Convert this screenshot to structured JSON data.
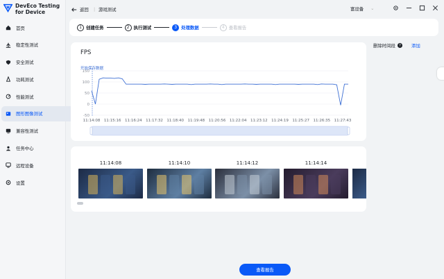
{
  "app": {
    "name_line1": "DevEco Testing",
    "name_line2": "for Device",
    "brand_color": "#0a59f7"
  },
  "sidebar": {
    "items": [
      {
        "label": "首页",
        "icon": "home-icon",
        "active": false
      },
      {
        "label": "稳定性测试",
        "icon": "stability-icon",
        "active": false
      },
      {
        "label": "安全测试",
        "icon": "shield-icon",
        "active": false
      },
      {
        "label": "功耗测试",
        "icon": "power-icon",
        "active": false
      },
      {
        "label": "性能测试",
        "icon": "performance-icon",
        "active": false
      },
      {
        "label": "图形图像测试",
        "icon": "image-icon",
        "active": true
      },
      {
        "label": "兼容性测试",
        "icon": "compatibility-icon",
        "active": false
      },
      {
        "label": "任务中心",
        "icon": "task-icon",
        "active": false
      },
      {
        "label": "远程设备",
        "icon": "remote-device-icon",
        "active": false
      },
      {
        "label": "设置",
        "icon": "settings-icon",
        "active": false
      }
    ]
  },
  "topbar": {
    "back_label": "返回",
    "breadcrumb": "游戏测试",
    "device_label": "富设备"
  },
  "stepper": {
    "steps": [
      {
        "num": "1",
        "label": "创建任务",
        "state": "done"
      },
      {
        "num": "2",
        "label": "执行测试",
        "state": "done"
      },
      {
        "num": "3",
        "label": "处理数据",
        "state": "current"
      },
      {
        "num": "4",
        "label": "查看报告",
        "state": "pending"
      }
    ]
  },
  "fps_card": {
    "title": "FPS",
    "marker_label": "开始保存数据"
  },
  "chart_data": {
    "type": "line",
    "title": "FPS",
    "ylim": [
      -50,
      150
    ],
    "yticks": [
      "150",
      "100",
      "50",
      "0",
      "-50"
    ],
    "xticks": [
      "11:14:08",
      "11:15:16",
      "11:16:24",
      "11:17:32",
      "11:18:40",
      "11:19:48",
      "11:20:56",
      "11:22:04",
      "11:23:12",
      "11:24:19",
      "11:25:27",
      "11:26:35",
      "11:27:43"
    ],
    "series": [
      {
        "values": [
          60,
          0,
          112,
          118,
          117,
          117,
          116,
          118,
          114,
          90,
          90,
          90,
          90,
          90,
          89,
          90,
          90,
          90,
          90,
          91,
          90,
          89,
          90,
          90,
          90,
          90,
          88,
          90,
          90,
          90,
          90,
          91,
          90,
          90,
          88,
          90,
          90,
          90,
          90,
          90,
          91,
          90,
          90,
          89,
          90,
          90,
          90,
          90,
          88,
          90,
          90,
          90,
          90,
          90,
          89,
          90,
          90,
          90,
          90,
          88,
          91,
          90,
          90,
          90,
          87,
          -5,
          90,
          90
        ]
      }
    ],
    "grid": true,
    "line_color": "#3d6fd4"
  },
  "right_panel": {
    "delete_label": "删除时间段",
    "add_label": "添加"
  },
  "screenshots": {
    "items": [
      {
        "time": "11:14:08"
      },
      {
        "time": "11:14:10"
      },
      {
        "time": "11:14:12"
      },
      {
        "time": "11:14:14"
      }
    ]
  },
  "footer": {
    "report_button": "查看报告"
  }
}
